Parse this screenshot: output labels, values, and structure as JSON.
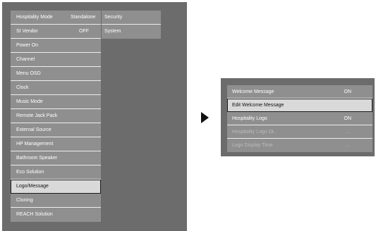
{
  "main_menu": {
    "items": [
      {
        "label": "Hospitality Mode",
        "value": "Standalone"
      },
      {
        "label": "SI Vendor",
        "value": "OFF"
      },
      {
        "label": "Power On",
        "value": ""
      },
      {
        "label": "Channel",
        "value": ""
      },
      {
        "label": "Menu OSD",
        "value": ""
      },
      {
        "label": "Clock",
        "value": ""
      },
      {
        "label": "Music Mode",
        "value": ""
      },
      {
        "label": "Remote Jack Pack",
        "value": ""
      },
      {
        "label": "External Source",
        "value": ""
      },
      {
        "label": "HP Management",
        "value": ""
      },
      {
        "label": "Bathroom Speaker",
        "value": ""
      },
      {
        "label": "Eco Solution",
        "value": ""
      },
      {
        "label": "Logo/Message",
        "value": ""
      },
      {
        "label": "Cloning",
        "value": ""
      },
      {
        "label": "REACH Solution",
        "value": ""
      }
    ],
    "selected_item": "Logo/Message"
  },
  "sub_menu": {
    "items": [
      "Security",
      "System"
    ]
  },
  "logo_message_menu": {
    "items": [
      {
        "label": "Welcome Message",
        "value": "ON"
      },
      {
        "label": "Edit Welcome Message",
        "value": ""
      },
      {
        "label": "Hospitality Logo",
        "value": "ON"
      },
      {
        "label": "Hospitality Logo DL",
        "value": "..."
      },
      {
        "label": "Logo Display Time",
        "value": "..."
      }
    ],
    "selected_item": "Edit Welcome Message",
    "disabled_items": [
      "Hospitality Logo DL",
      "Logo Display Time"
    ]
  },
  "icons": {
    "arrow": "arrow-right-icon"
  },
  "colors": {
    "panel_background": "#6c6c6c",
    "menu_background": "#8f8f8f",
    "selected_background": "#d9d9d9",
    "text": "#ffffff"
  }
}
